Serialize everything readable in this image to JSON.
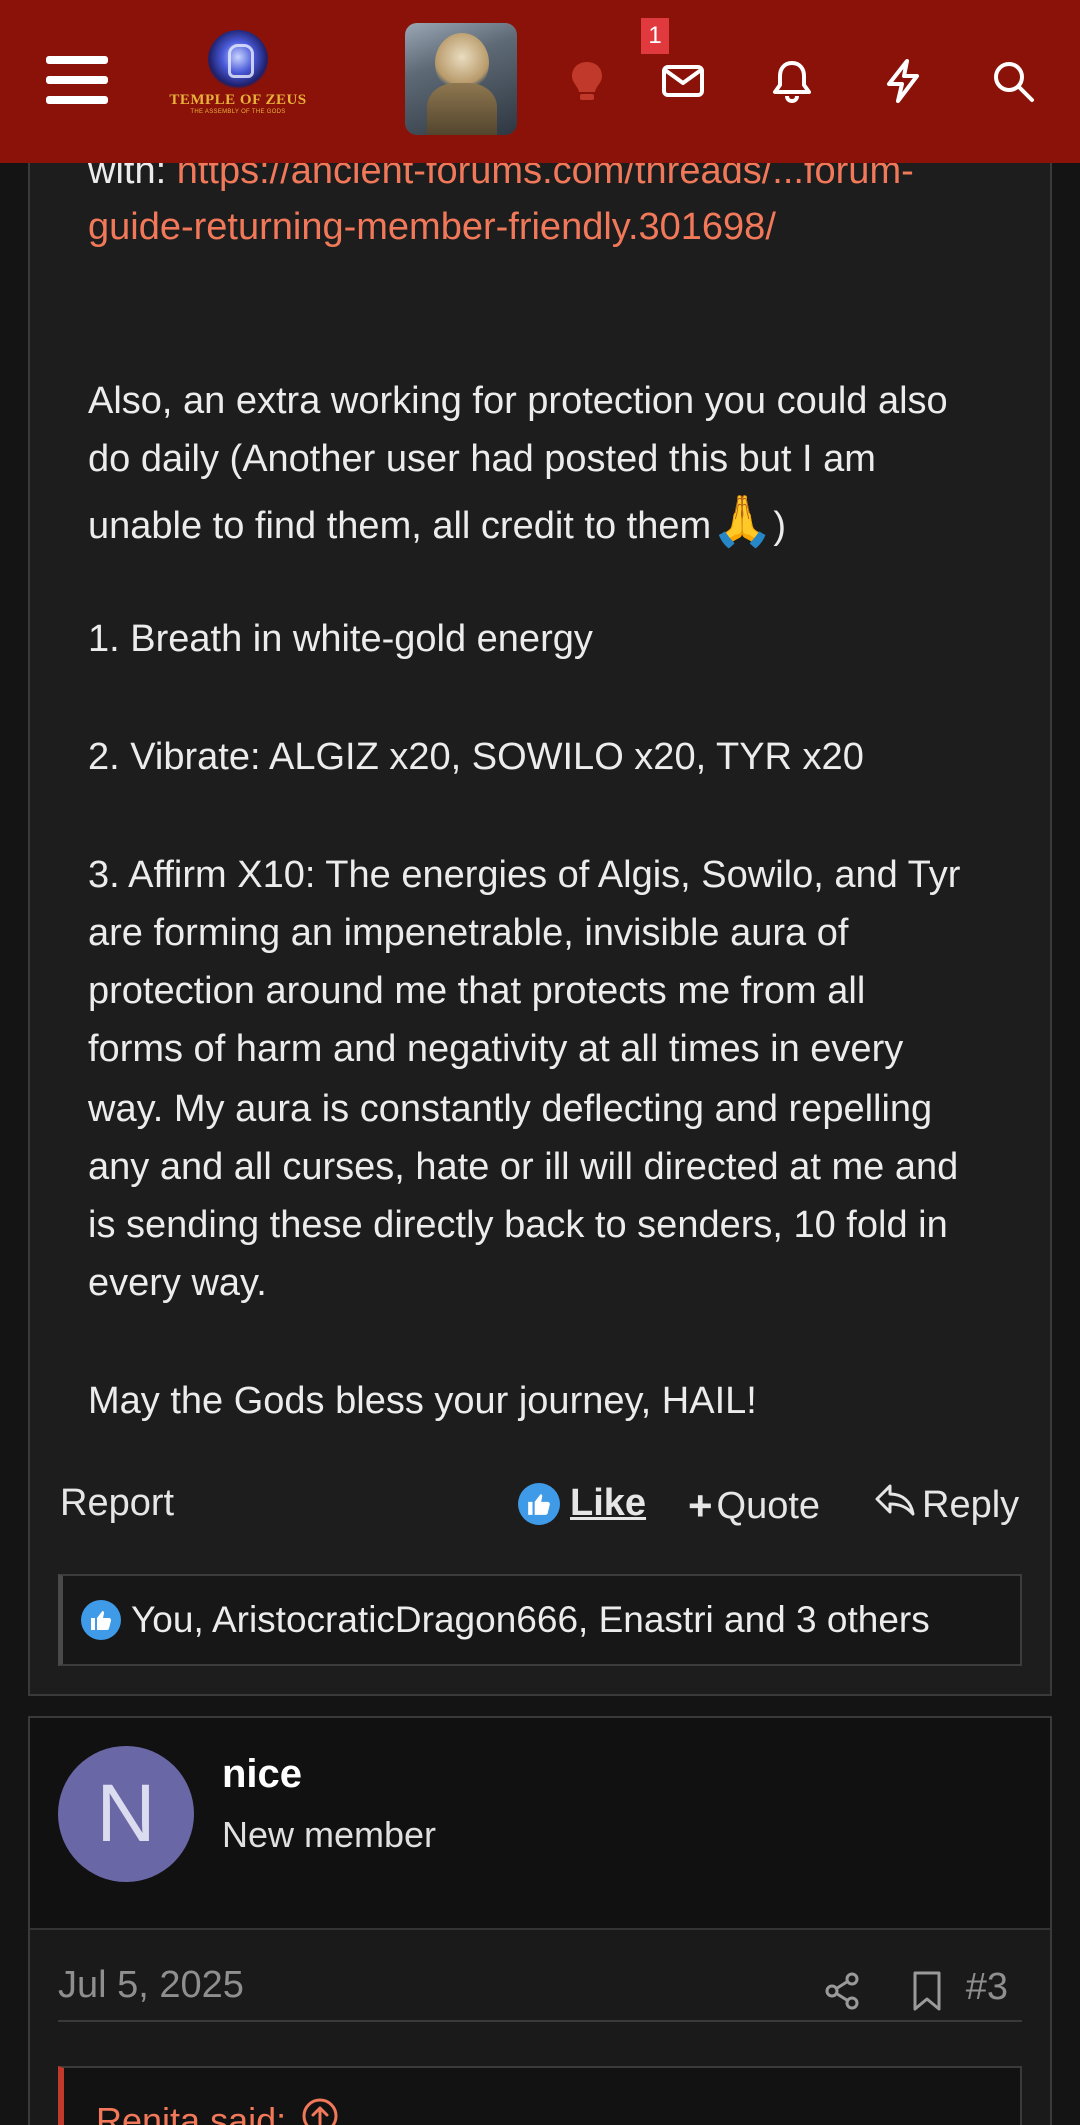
{
  "header": {
    "logo_title": "TEMPLE OF ZEUS",
    "logo_subtitle": "THE ASSEMBLY OF THE GODS",
    "badge_count": "1"
  },
  "post": {
    "link_prefix": "with: ",
    "link_line1": "https://ancient-forums.com/threads/...forum-",
    "link_line2": "guide-returning-member-friendly.301698/",
    "para1_line1": "Also, an extra working for protection you could also",
    "para1_line2": "do daily (Another user had posted this but I am",
    "para1_line3": "unable to find them, all credit to them",
    "para1_emoji": "🙏",
    "para1_close": ")",
    "step1": "1. Breath in white-gold energy",
    "step2": "2. Vibrate: ALGIZ x20, SOWILO x20, TYR x20",
    "step3_lines": [
      "3. Affirm X10: The energies of Algis, Sowilo, and Tyr",
      "are forming an impenetrable, invisible aura of",
      "protection around me that protects me from all",
      "forms of harm and negativity at all times in every",
      "way. My aura is constantly deflecting and repelling",
      "any and all curses, hate or ill will directed at me and",
      "is sending these directly back to senders, 10 fold in",
      "every way."
    ],
    "closing": "May the Gods bless your journey, HAIL!",
    "actions": {
      "report": "Report",
      "like": "Like",
      "quote": "Quote",
      "reply": "Reply"
    },
    "reactions_text": "You, AristocraticDragon666, Enastri and 3 others"
  },
  "post2": {
    "avatar_letter": "N",
    "username": "nice",
    "user_title": "New member",
    "date": "Jul 5, 2025",
    "post_number": "#3",
    "quote_author": "Renita said:"
  },
  "colors": {
    "header_bg": "#8b1208",
    "link": "#f2785a",
    "like_blue": "#3f9be8",
    "avatar_purple": "#6a67a6"
  }
}
